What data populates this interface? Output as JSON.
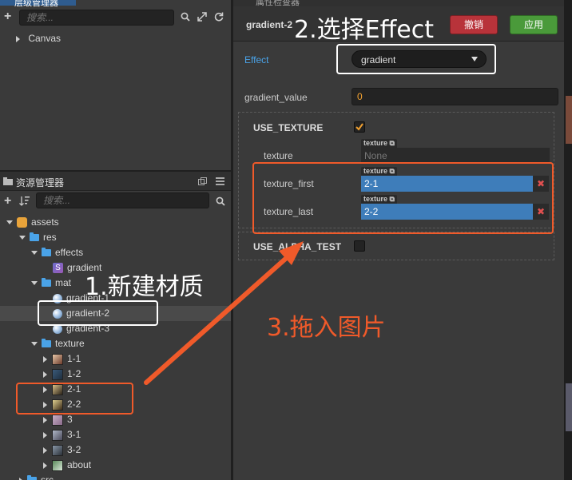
{
  "hierarchy": {
    "tab_title": "层级管理器",
    "search_placeholder": "搜索...",
    "root_node": "Canvas"
  },
  "assets": {
    "tab_title": "资源管理器",
    "search_placeholder": "搜索...",
    "tree": {
      "root": "assets",
      "res": "res",
      "effects": "effects",
      "effect_file": "gradient",
      "mat": "mat",
      "mat_1": "gradient-1",
      "mat_2": "gradient-2",
      "mat_3": "gradient-3",
      "texture": "texture",
      "tex_1_1": "1-1",
      "tex_1_2": "1-2",
      "tex_2_1": "2-1",
      "tex_2_2": "2-2",
      "tex_3": "3",
      "tex_3_1": "3-1",
      "tex_3_2": "3-2",
      "tex_about": "about",
      "src": "src"
    }
  },
  "inspector": {
    "tab_title": "属性检查器",
    "asset_name": "gradient-2",
    "revert_label": "撤销",
    "apply_label": "应用",
    "effect_label": "Effect",
    "effect_value": "gradient",
    "gradient_value_label": "gradient_value",
    "gradient_value": "0",
    "use_texture_label": "USE_TEXTURE",
    "use_texture_checked": true,
    "texture_label": "texture",
    "texture_tag": "texture",
    "texture_value": "None",
    "texture_first_label": "texture_first",
    "texture_first_value": "2-1",
    "texture_last_label": "texture_last",
    "texture_last_value": "2-2",
    "use_alpha_test_label": "USE_ALPHA_TEST",
    "use_alpha_test_checked": false
  },
  "annotations": {
    "step1": "1.新建材质",
    "step2": "2.选择Effect",
    "step3": "3.拖入图片"
  },
  "colors": {
    "accent_blue": "#3e7dba",
    "revert_red": "#b8333a",
    "apply_green": "#4a9a3a",
    "annotation_red": "#f05a2a",
    "annotation_white": "#ffffff",
    "checkbox_orange": "#f0a030"
  },
  "icons": {
    "add": "plus-icon",
    "sort": "sort-icon",
    "search": "search-icon",
    "expand": "expand-icon",
    "refresh": "refresh-icon",
    "menu": "menu-icon",
    "dropdown": "caret-down-icon",
    "clear": "close-icon"
  }
}
